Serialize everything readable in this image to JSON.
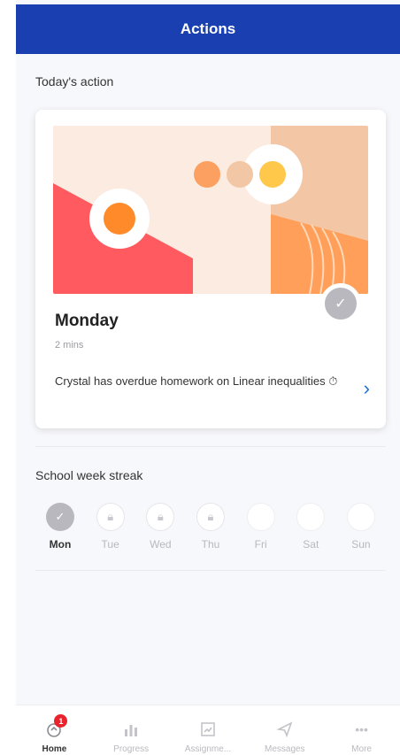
{
  "header": {
    "title": "Actions"
  },
  "today": {
    "section_title": "Today's action",
    "card": {
      "day": "Monday",
      "duration": "2 mins",
      "message": "Crystal has overdue homework on Linear inequalities",
      "status": "completed"
    }
  },
  "streak": {
    "section_title": "School week streak",
    "days": [
      {
        "label": "Mon",
        "state": "done"
      },
      {
        "label": "Tue",
        "state": "locked"
      },
      {
        "label": "Wed",
        "state": "locked"
      },
      {
        "label": "Thu",
        "state": "locked"
      },
      {
        "label": "Fri",
        "state": "empty"
      },
      {
        "label": "Sat",
        "state": "empty"
      },
      {
        "label": "Sun",
        "state": "empty"
      }
    ]
  },
  "tabbar": {
    "items": [
      {
        "label": "Home",
        "icon": "rocket-icon",
        "badge": "1"
      },
      {
        "label": "Progress",
        "icon": "bar-chart-icon"
      },
      {
        "label": "Assignme...",
        "icon": "assignment-icon"
      },
      {
        "label": "Messages",
        "icon": "send-icon"
      },
      {
        "label": "More",
        "icon": "ellipsis-icon"
      }
    ]
  },
  "colors": {
    "header": "#1a3fb0",
    "link": "#1a6fd6",
    "badge": "#e8232d",
    "art_red": "#ff5a5f",
    "art_orange": "#ff9f5a",
    "art_peach": "#f3c7a6"
  }
}
